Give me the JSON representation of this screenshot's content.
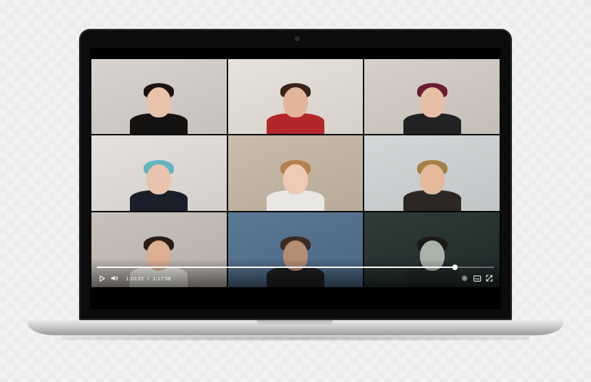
{
  "player": {
    "current_time": "1:10:22",
    "separator": "/",
    "duration": "1:17:58",
    "progress": 0.902
  },
  "icons": {
    "play": "play-icon",
    "volume": "volume-icon",
    "settings": "gear-icon",
    "captions": "captions-icon",
    "fullscreen": "fullscreen-icon"
  },
  "colors": {
    "bezel": "#0c0c0c",
    "chassis": "#c9c9cb",
    "progress": "#ffffff"
  },
  "participants": [
    {
      "bg": "#d9d3cf",
      "skin": "#e8c2aa",
      "hair": "#1d1412",
      "shirt": "#151212"
    },
    {
      "bg": "#e7e2db",
      "skin": "#e2b59b",
      "hair": "#3a2418",
      "shirt": "#b3262a"
    },
    {
      "bg": "#d6d0c9",
      "skin": "#e7bfa8",
      "hair": "#6a1d2e",
      "shirt": "#222"
    },
    {
      "bg": "#e4e1de",
      "skin": "#e8c3ad",
      "hair": "#63b5c1",
      "shirt": "#1a1d2a"
    },
    {
      "bg": "#c9bcaa",
      "skin": "#efcab4",
      "hair": "#b3824e",
      "shirt": "#e9e7e4"
    },
    {
      "bg": "#d3d7d8",
      "skin": "#e5b99c",
      "hair": "#a78046",
      "shirt": "#2c2722"
    },
    {
      "bg": "#c8c1bc",
      "skin": "#dcae92",
      "hair": "#2b1d16",
      "shirt": "#ece9e4"
    },
    {
      "bg": "#5b7894",
      "skin": "#b58c74",
      "hair": "#3b2b22",
      "shirt": "#1f1f22"
    },
    {
      "bg": "#2e3c3a",
      "skin": "#a9b3a8",
      "hair": "#1c1a16",
      "shirt": "#25292a"
    }
  ]
}
